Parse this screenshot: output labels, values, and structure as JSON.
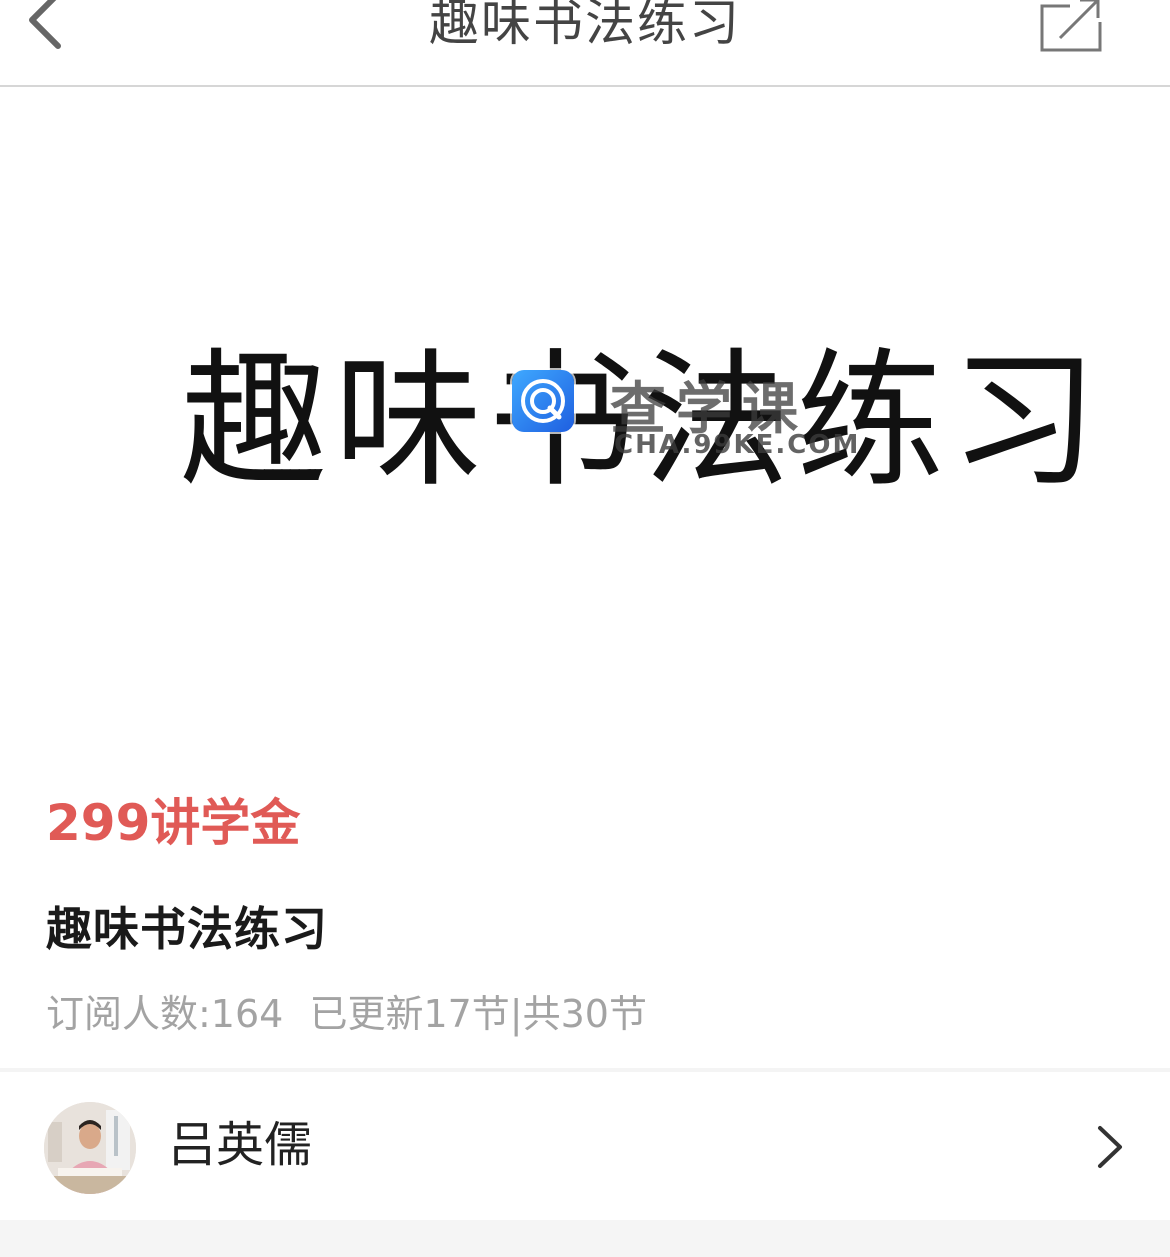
{
  "navbar": {
    "title": "趣味书法练习",
    "back_icon": "chevron-left-icon",
    "share_icon": "share-external-icon"
  },
  "cover": {
    "text": "趣味书法练习",
    "watermark": {
      "brand": "查学课",
      "url": "CHA.99KE.COM",
      "logo_icon": "search-logo-icon"
    }
  },
  "course": {
    "price": "299讲学金",
    "title": "趣味书法练习",
    "subscribers": "订阅人数:164",
    "updated": "已更新17节",
    "separator": "|",
    "total": "共30节"
  },
  "teacher": {
    "name": "吕英儒",
    "arrow_icon": "chevron-right-icon"
  },
  "colors": {
    "price": "#e05a56",
    "title": "#1a1a1a",
    "meta": "#a3a3a3",
    "divider": "#f4f4f4",
    "nav_border": "#d6d6d6"
  }
}
